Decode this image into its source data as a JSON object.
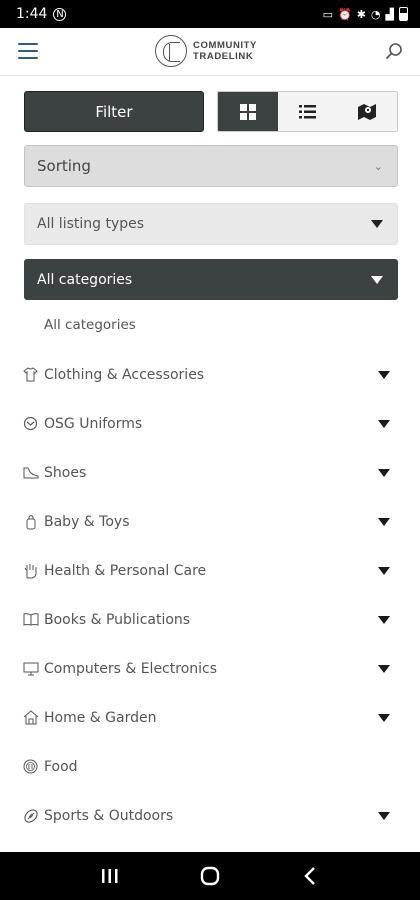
{
  "status_bar": {
    "time": "1:44",
    "indicators": [
      "N-icon",
      "cast-icon",
      "alarm-icon",
      "bluetooth-icon",
      "wifi-icon",
      "signal-icon",
      "battery-icon"
    ]
  },
  "header": {
    "logo_line1": "COMMUNITY",
    "logo_line2": "TRADELINK",
    "menu_icon": "hamburger-icon",
    "search_icon": "search-icon"
  },
  "controls": {
    "filter_label": "Filter",
    "views": [
      {
        "name": "grid-view",
        "icon": "grid-icon",
        "active": true
      },
      {
        "name": "list-view",
        "icon": "list-icon",
        "active": false
      },
      {
        "name": "map-view",
        "icon": "map-icon",
        "active": false
      }
    ],
    "sorting_label": "Sorting",
    "listing_types_label": "All listing types",
    "categories_label": "All categories"
  },
  "categories": {
    "all_label": "All categories",
    "items": [
      {
        "label": "Clothing & Accessories",
        "icon": "shirt-icon",
        "expandable": true
      },
      {
        "label": "OSG Uniforms",
        "icon": "uniform-icon",
        "expandable": true
      },
      {
        "label": "Shoes",
        "icon": "shoe-icon",
        "expandable": true
      },
      {
        "label": "Baby & Toys",
        "icon": "baby-bottle-icon",
        "expandable": true
      },
      {
        "label": "Health & Personal Care",
        "icon": "hand-icon",
        "expandable": true
      },
      {
        "label": "Books & Publications",
        "icon": "book-icon",
        "expandable": true
      },
      {
        "label": "Computers & Electronics",
        "icon": "monitor-icon",
        "expandable": true
      },
      {
        "label": "Home & Garden",
        "icon": "house-icon",
        "expandable": true
      },
      {
        "label": "Food",
        "icon": "food-icon",
        "expandable": false
      },
      {
        "label": "Sports & Outdoors",
        "icon": "ball-icon",
        "expandable": true
      }
    ]
  },
  "colors": {
    "dark_button": "#3c4242",
    "menu_icon": "#2f5f7c",
    "select_bg": "#dddddd"
  }
}
